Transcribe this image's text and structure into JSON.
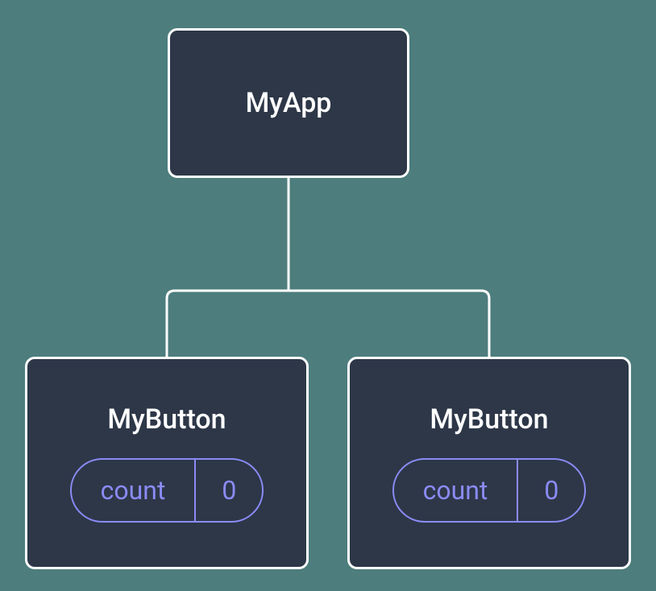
{
  "root": {
    "label": "MyApp"
  },
  "children": [
    {
      "label": "MyButton",
      "state": {
        "name": "count",
        "value": "0"
      }
    },
    {
      "label": "MyButton",
      "state": {
        "name": "count",
        "value": "0"
      }
    }
  ],
  "colors": {
    "background": "#4d7d7d",
    "node_fill": "#2d3748",
    "node_border": "#ffffff",
    "accent": "#8b8bf5"
  }
}
